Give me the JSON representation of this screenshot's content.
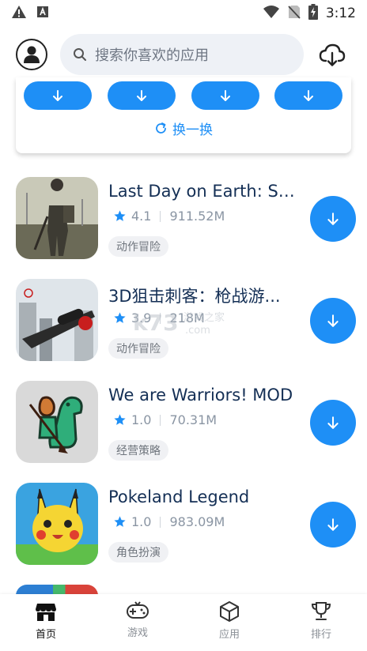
{
  "status_bar": {
    "time": "3:12"
  },
  "header": {
    "search_placeholder": "搜索你喜欢的应用"
  },
  "recommend": {
    "refresh_label": "换一换"
  },
  "apps": [
    {
      "title": "Last Day on Earth: Su...",
      "rating": "4.1",
      "size": "911.52M",
      "tag": "动作冒险"
    },
    {
      "title": "3D狙击刺客：枪战游...",
      "rating": "3.9",
      "size": "218M",
      "tag": "动作冒险"
    },
    {
      "title": "We are Warriors! MOD",
      "rating": "1.0",
      "size": "70.31M",
      "tag": "经营策略"
    },
    {
      "title": "Pokeland Legend",
      "rating": "1.0",
      "size": "983.09M",
      "tag": "角色扮演"
    }
  ],
  "watermark": {
    "brand": "k73",
    "sub": "游戏之家",
    "domain": ".com"
  },
  "bottom_nav": [
    {
      "label": "首页"
    },
    {
      "label": "游戏"
    },
    {
      "label": "应用"
    },
    {
      "label": "排行"
    }
  ],
  "colors": {
    "accent": "#1e8ff6",
    "title": "#142f55",
    "star": "#1e8ff6"
  }
}
